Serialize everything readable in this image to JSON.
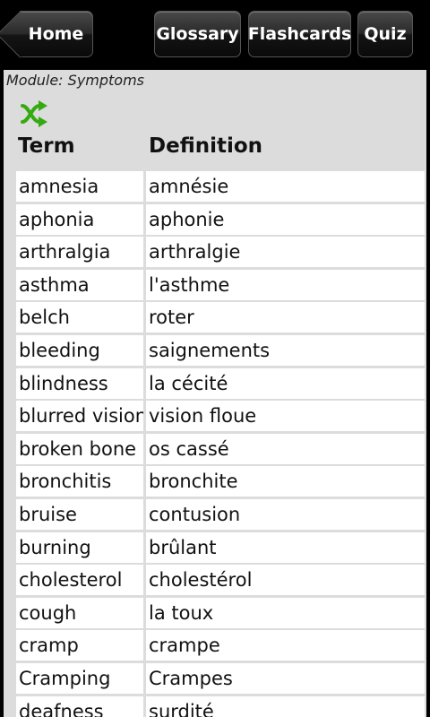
{
  "nav": {
    "home": "Home",
    "glossary": "Glossary",
    "flashcards": "Flashcards",
    "quiz": "Quiz"
  },
  "module_label": "Module: Symptoms",
  "shuffle_icon": "shuffle-icon",
  "shuffle_color": "#33aa11",
  "table": {
    "headers": [
      "Term",
      "Definition"
    ],
    "rows": [
      [
        "amnesia",
        "amnésie"
      ],
      [
        "aphonia",
        "aphonie"
      ],
      [
        "arthralgia",
        "arthralgie"
      ],
      [
        "asthma",
        "l'asthme"
      ],
      [
        "belch",
        "roter"
      ],
      [
        "bleeding",
        "saignements"
      ],
      [
        "blindness",
        "la cécité"
      ],
      [
        "blurred vision",
        "vision floue"
      ],
      [
        "broken bone",
        "os cassé"
      ],
      [
        "bronchitis",
        "bronchite"
      ],
      [
        "bruise",
        "contusion"
      ],
      [
        "burning",
        "brûlant"
      ],
      [
        "cholesterol",
        "cholestérol"
      ],
      [
        "cough",
        "la toux"
      ],
      [
        "cramp",
        "crampe"
      ],
      [
        "Cramping",
        "Crampes"
      ],
      [
        "deafness",
        "surdité"
      ]
    ]
  }
}
